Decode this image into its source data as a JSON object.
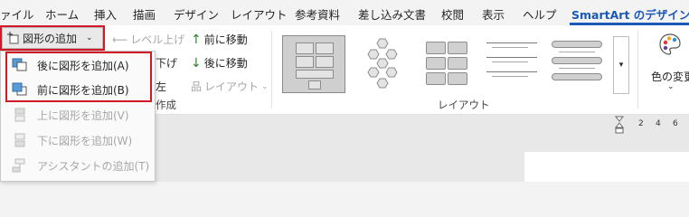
{
  "tabs": [
    {
      "label": "ァイル"
    },
    {
      "label": "ホーム"
    },
    {
      "label": "挿入"
    },
    {
      "label": "描画"
    },
    {
      "label": "デザイン"
    },
    {
      "label": "レイアウト"
    },
    {
      "label": "参考資料"
    },
    {
      "label": "差し込み文書"
    },
    {
      "label": "校閲"
    },
    {
      "label": "表示"
    },
    {
      "label": "ヘルプ"
    },
    {
      "label": "SmartArt のデザイン"
    }
  ],
  "create_group": {
    "add_shape_label": "図形の追加",
    "level_up_label": "レベル上げ",
    "level_down_label": "下げ",
    "right_to_left_label": "左",
    "move_up_label": "前に移動",
    "move_down_label": "後に移動",
    "layout_label": "レイアウト",
    "group_label_partial": "作成"
  },
  "layouts_group": {
    "group_label": "レイアウト"
  },
  "colors_group": {
    "change_colors_label": "色の変更"
  },
  "add_shape_menu": {
    "items": [
      {
        "label": "後に図形を追加(A)",
        "enabled": true
      },
      {
        "label": "前に図形を追加(B)",
        "enabled": true
      },
      {
        "label": "上に図形を追加(V)",
        "enabled": false
      },
      {
        "label": "下に図形を追加(W)",
        "enabled": false
      },
      {
        "label": "アシスタントの追加(T)",
        "enabled": false
      }
    ]
  },
  "ruler": {
    "marks": [
      "2",
      "4",
      "6"
    ]
  },
  "colors": {
    "accent": "#1b58b8",
    "highlight": "#d11a26",
    "disabled": "#a6a6a6"
  }
}
